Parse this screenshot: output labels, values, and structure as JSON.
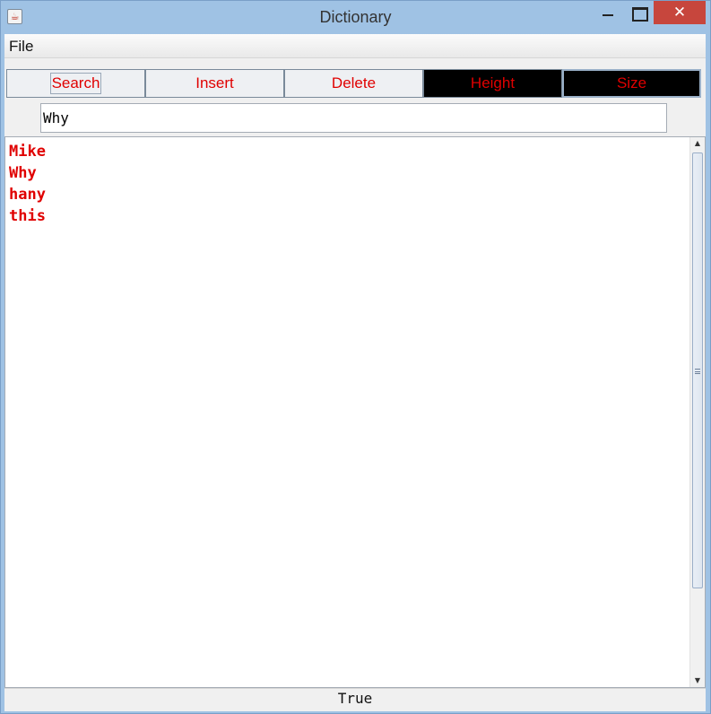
{
  "window": {
    "title": "Dictionary",
    "close_glyph": "✕",
    "app_icon": "java-cup-icon"
  },
  "menubar": {
    "file_label": "File"
  },
  "toolbar": {
    "search_label": "Search",
    "insert_label": "Insert",
    "delete_label": "Delete",
    "height_label": "Height",
    "size_label": "Size"
  },
  "search": {
    "value": "Why"
  },
  "words": {
    "items": [
      "Mike",
      "Why",
      "hany",
      "this"
    ]
  },
  "status": {
    "text": "True"
  },
  "colors": {
    "text_accent": "#e00000",
    "dark_button": "#000000",
    "titlebar": "#9fc2e4",
    "close_button": "#c7463d"
  },
  "scrollbar": {
    "up_glyph": "▲",
    "down_glyph": "▼"
  }
}
